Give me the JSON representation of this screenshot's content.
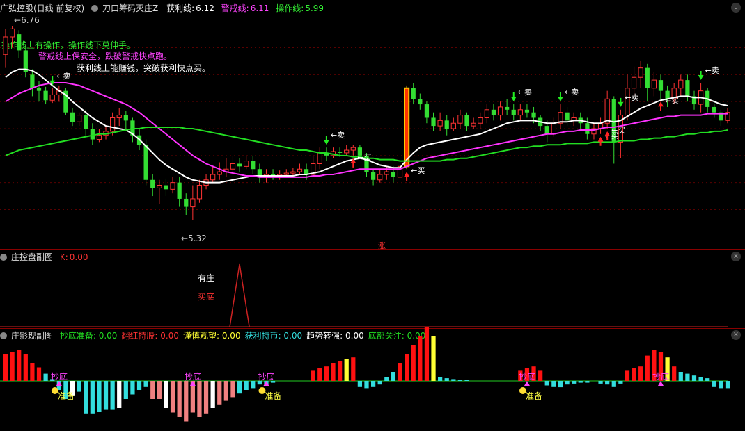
{
  "header": {
    "stock": "广弘控股(日线 前复权)",
    "indicator": "刀口筹码灭庄Z",
    "profit_label": "获利线:",
    "profit_value": "6.12",
    "warn_label": "警戒线:",
    "warn_value": "6.11",
    "op_label": "操作线:",
    "op_value": "5.99"
  },
  "notes": {
    "n1": "操作线上有操作，操作线下莫伸手。",
    "n2": "警戒线上保安全，跌破警戒快点跑。",
    "n3": "获利线上能赚钱，突破获利快点买。",
    "high_label": "6.76",
    "low_label": "5.32",
    "zhang": "涨"
  },
  "panel2": {
    "title": "庄控盘副图",
    "k_label": "K:",
    "k_value": "0.00",
    "you_zhuang": "有庄",
    "mai_di": "买底"
  },
  "panel3": {
    "title": "庄影现副图",
    "items": [
      {
        "label": "抄底准备:",
        "value": "0.00",
        "color": "#22dd22"
      },
      {
        "label": "翻红持股:",
        "value": "0.00",
        "color": "#ff3333"
      },
      {
        "label": "谨慎观望:",
        "value": "0.00",
        "color": "#ffff33"
      },
      {
        "label": "获利持币:",
        "value": "0.00",
        "color": "#33dddd"
      },
      {
        "label": "趋势转强:",
        "value": "0.00",
        "color": "#ffffff"
      },
      {
        "label": "底部关注:",
        "value": "0.00",
        "color": "#22dd22"
      }
    ],
    "chaodi": "抄底",
    "zhunbei": "准备"
  },
  "signals": {
    "buy": "买",
    "sell": "卖"
  },
  "colors": {
    "up": "#ff3333",
    "down": "#33dd33",
    "white": "#ffffff",
    "magenta": "#ff33ff",
    "green": "#22dd22"
  },
  "chart_data": {
    "type": "candlestick",
    "candles": [
      [
        6.55,
        6.68,
        6.74,
        6.45
      ],
      [
        6.68,
        6.74,
        6.76,
        6.6
      ],
      [
        6.7,
        6.58,
        6.73,
        6.52
      ],
      [
        6.58,
        6.42,
        6.62,
        6.38
      ],
      [
        6.4,
        6.3,
        6.44,
        6.24
      ],
      [
        6.3,
        6.28,
        6.35,
        6.2
      ],
      [
        6.28,
        6.21,
        6.31,
        6.18
      ],
      [
        6.21,
        6.25,
        6.3,
        6.19
      ],
      [
        6.25,
        6.28,
        6.32,
        6.2
      ],
      [
        6.28,
        6.12,
        6.3,
        6.1
      ],
      [
        6.12,
        6.05,
        6.15,
        6.02
      ],
      [
        6.05,
        6.1,
        6.12,
        6.02
      ],
      [
        6.1,
        6.0,
        6.14,
        5.95
      ],
      [
        6.0,
        5.92,
        6.04,
        5.88
      ],
      [
        5.92,
        5.95,
        6.0,
        5.9
      ],
      [
        5.95,
        5.98,
        6.02,
        5.92
      ],
      [
        5.98,
        6.08,
        6.12,
        5.95
      ],
      [
        6.08,
        6.1,
        6.15,
        6.02
      ],
      [
        6.1,
        6.06,
        6.13,
        6.0
      ],
      [
        6.06,
        5.95,
        6.08,
        5.9
      ],
      [
        5.95,
        5.88,
        6.0,
        5.84
      ],
      [
        5.88,
        5.62,
        5.92,
        5.58
      ],
      [
        5.62,
        5.56,
        5.66,
        5.5
      ],
      [
        5.56,
        5.58,
        5.62,
        5.44
      ],
      [
        5.58,
        5.55,
        5.63,
        5.5
      ],
      [
        5.55,
        5.6,
        5.64,
        5.52
      ],
      [
        5.6,
        5.48,
        5.64,
        5.42
      ],
      [
        5.48,
        5.42,
        5.52,
        5.36
      ],
      [
        5.42,
        5.48,
        5.58,
        5.32
      ],
      [
        5.48,
        5.58,
        5.62,
        5.45
      ],
      [
        5.58,
        5.62,
        5.66,
        5.55
      ],
      [
        5.62,
        5.66,
        5.72,
        5.6
      ],
      [
        5.66,
        5.68,
        5.75,
        5.62
      ],
      [
        5.68,
        5.7,
        5.78,
        5.64
      ],
      [
        5.7,
        5.74,
        5.8,
        5.66
      ],
      [
        5.74,
        5.72,
        5.78,
        5.68
      ],
      [
        5.72,
        5.76,
        5.8,
        5.7
      ],
      [
        5.76,
        5.7,
        5.8,
        5.66
      ],
      [
        5.7,
        5.64,
        5.74,
        5.6
      ],
      [
        5.64,
        5.66,
        5.7,
        5.6
      ],
      [
        5.66,
        5.65,
        5.7,
        5.62
      ],
      [
        5.65,
        5.66,
        5.69,
        5.62
      ],
      [
        5.66,
        5.67,
        5.7,
        5.64
      ],
      [
        5.67,
        5.68,
        5.71,
        5.64
      ],
      [
        5.68,
        5.7,
        5.74,
        5.66
      ],
      [
        5.7,
        5.66,
        5.74,
        5.62
      ],
      [
        5.66,
        5.74,
        5.8,
        5.64
      ],
      [
        5.74,
        5.82,
        5.86,
        5.7
      ],
      [
        5.82,
        5.8,
        5.86,
        5.76
      ],
      [
        5.8,
        5.83,
        5.86,
        5.78
      ],
      [
        5.83,
        5.82,
        5.86,
        5.79
      ],
      [
        5.82,
        5.84,
        5.88,
        5.8
      ],
      [
        5.84,
        5.86,
        5.88,
        5.8
      ],
      [
        5.86,
        5.8,
        5.88,
        5.78
      ],
      [
        5.8,
        5.68,
        5.82,
        5.64
      ],
      [
        5.68,
        5.62,
        5.7,
        5.58
      ],
      [
        5.62,
        5.66,
        5.7,
        5.6
      ],
      [
        5.66,
        5.68,
        5.72,
        5.62
      ],
      [
        5.68,
        5.64,
        5.72,
        5.6
      ],
      [
        5.64,
        5.72,
        5.76,
        5.6
      ],
      [
        5.72,
        6.3,
        6.32,
        5.7
      ],
      [
        6.3,
        6.22,
        6.34,
        6.18
      ],
      [
        6.22,
        6.18,
        6.26,
        6.14
      ],
      [
        6.18,
        6.08,
        6.2,
        6.04
      ],
      [
        6.08,
        6.02,
        6.12,
        5.98
      ],
      [
        6.02,
        6.06,
        6.12,
        5.98
      ],
      [
        6.06,
        6.0,
        6.1,
        5.95
      ],
      [
        6.0,
        6.04,
        6.08,
        5.98
      ],
      [
        6.04,
        6.1,
        6.14,
        6.0
      ],
      [
        6.1,
        6.02,
        6.12,
        5.98
      ],
      [
        6.02,
        6.04,
        6.08,
        6.0
      ],
      [
        6.04,
        6.08,
        6.12,
        6.0
      ],
      [
        6.08,
        6.14,
        6.18,
        6.04
      ],
      [
        6.14,
        6.1,
        6.18,
        6.06
      ],
      [
        6.1,
        6.16,
        6.2,
        6.06
      ],
      [
        6.16,
        6.14,
        6.22,
        6.1
      ],
      [
        6.14,
        6.1,
        6.18,
        6.06
      ],
      [
        6.1,
        6.14,
        6.18,
        6.06
      ],
      [
        6.14,
        6.12,
        6.18,
        6.08
      ],
      [
        6.12,
        6.08,
        6.16,
        6.04
      ],
      [
        6.08,
        6.02,
        6.1,
        5.98
      ],
      [
        6.02,
        5.96,
        6.06,
        5.9
      ],
      [
        5.96,
        6.04,
        6.08,
        5.94
      ],
      [
        6.04,
        6.12,
        6.18,
        6.0
      ],
      [
        6.12,
        6.06,
        6.16,
        6.02
      ],
      [
        6.06,
        6.08,
        6.12,
        6.02
      ],
      [
        6.08,
        6.04,
        6.12,
        5.98
      ],
      [
        6.04,
        5.96,
        6.08,
        5.92
      ],
      [
        5.96,
        6.0,
        6.04,
        5.92
      ],
      [
        6.0,
        6.04,
        6.08,
        5.96
      ],
      [
        6.04,
        6.22,
        6.28,
        6.0
      ],
      [
        6.22,
        5.9,
        6.24,
        5.74
      ],
      [
        5.9,
        6.1,
        6.14,
        5.78
      ],
      [
        6.1,
        6.3,
        6.4,
        6.06
      ],
      [
        6.3,
        6.38,
        6.46,
        6.24
      ],
      [
        6.38,
        6.45,
        6.5,
        6.3
      ],
      [
        6.45,
        6.3,
        6.48,
        6.2
      ],
      [
        6.3,
        6.36,
        6.42,
        6.24
      ],
      [
        6.36,
        6.28,
        6.4,
        6.22
      ],
      [
        6.28,
        6.22,
        6.32,
        6.16
      ],
      [
        6.22,
        6.3,
        6.34,
        6.18
      ],
      [
        6.3,
        6.36,
        6.4,
        6.24
      ],
      [
        6.36,
        6.24,
        6.4,
        6.2
      ],
      [
        6.24,
        6.18,
        6.28,
        6.14
      ],
      [
        6.18,
        6.28,
        6.34,
        6.12
      ],
      [
        6.28,
        6.16,
        6.3,
        6.12
      ],
      [
        6.16,
        6.12,
        6.18,
        6.08
      ],
      [
        6.12,
        6.06,
        6.14,
        6.02
      ],
      [
        6.06,
        6.12,
        6.15,
        6.04
      ]
    ],
    "ylim": [
      5.15,
      6.85
    ],
    "high_label": 6.76,
    "low_label": 5.32,
    "lines": [
      {
        "name": "获利线",
        "color": "#ffffff",
        "values": [
          6.38,
          6.42,
          6.44,
          6.44,
          6.43,
          6.4,
          6.36,
          6.32,
          6.28,
          6.25,
          6.2,
          6.16,
          6.12,
          6.08,
          6.05,
          6.02,
          6.01,
          6.0,
          5.99,
          5.96,
          5.92,
          5.87,
          5.82,
          5.77,
          5.73,
          5.7,
          5.67,
          5.64,
          5.62,
          5.61,
          5.6,
          5.6,
          5.6,
          5.61,
          5.62,
          5.63,
          5.64,
          5.65,
          5.65,
          5.65,
          5.65,
          5.65,
          5.65,
          5.65,
          5.66,
          5.66,
          5.67,
          5.68,
          5.7,
          5.72,
          5.74,
          5.76,
          5.77,
          5.78,
          5.77,
          5.75,
          5.73,
          5.72,
          5.71,
          5.71,
          5.77,
          5.82,
          5.86,
          5.88,
          5.89,
          5.9,
          5.91,
          5.92,
          5.93,
          5.94,
          5.95,
          5.96,
          5.98,
          6.0,
          6.02,
          6.04,
          6.05,
          6.06,
          6.06,
          6.06,
          6.05,
          6.04,
          6.04,
          6.05,
          6.05,
          6.06,
          6.06,
          6.05,
          6.04,
          6.04,
          6.06,
          6.05,
          6.06,
          6.09,
          6.12,
          6.15,
          6.17,
          6.19,
          6.21,
          6.22,
          6.23,
          6.24,
          6.24,
          6.23,
          6.23,
          6.22,
          6.2,
          6.18,
          6.17
        ]
      },
      {
        "name": "警戒线",
        "color": "#ff33ff",
        "values": [
          6.2,
          6.23,
          6.26,
          6.28,
          6.3,
          6.32,
          6.33,
          6.34,
          6.34,
          6.34,
          6.33,
          6.32,
          6.3,
          6.28,
          6.26,
          6.24,
          6.22,
          6.2,
          6.18,
          6.15,
          6.12,
          6.08,
          6.04,
          6.0,
          5.96,
          5.92,
          5.88,
          5.84,
          5.8,
          5.77,
          5.74,
          5.72,
          5.7,
          5.68,
          5.67,
          5.66,
          5.65,
          5.65,
          5.64,
          5.64,
          5.64,
          5.64,
          5.64,
          5.64,
          5.64,
          5.64,
          5.65,
          5.65,
          5.66,
          5.66,
          5.67,
          5.68,
          5.69,
          5.7,
          5.7,
          5.7,
          5.7,
          5.7,
          5.7,
          5.7,
          5.72,
          5.74,
          5.76,
          5.78,
          5.79,
          5.8,
          5.81,
          5.82,
          5.83,
          5.84,
          5.85,
          5.86,
          5.87,
          5.88,
          5.89,
          5.9,
          5.91,
          5.92,
          5.93,
          5.94,
          5.95,
          5.96,
          5.96,
          5.97,
          5.98,
          5.98,
          5.99,
          5.99,
          5.99,
          6.0,
          6.01,
          6.01,
          6.02,
          6.03,
          6.04,
          6.05,
          6.06,
          6.07,
          6.08,
          6.09,
          6.09,
          6.1,
          6.1,
          6.1,
          6.1,
          6.11,
          6.11,
          6.11,
          6.11
        ]
      },
      {
        "name": "操作线",
        "color": "#22dd22",
        "values": [
          5.8,
          5.82,
          5.84,
          5.85,
          5.86,
          5.87,
          5.88,
          5.89,
          5.9,
          5.91,
          5.92,
          5.93,
          5.94,
          5.95,
          5.96,
          5.96,
          5.97,
          5.98,
          5.99,
          6.0,
          6.0,
          6.01,
          6.01,
          6.01,
          6.01,
          6.01,
          6.01,
          6.0,
          6.0,
          5.99,
          5.98,
          5.97,
          5.96,
          5.95,
          5.94,
          5.93,
          5.92,
          5.91,
          5.9,
          5.89,
          5.88,
          5.87,
          5.86,
          5.85,
          5.84,
          5.84,
          5.83,
          5.82,
          5.82,
          5.81,
          5.8,
          5.8,
          5.79,
          5.79,
          5.78,
          5.78,
          5.77,
          5.77,
          5.77,
          5.76,
          5.76,
          5.76,
          5.76,
          5.76,
          5.76,
          5.76,
          5.77,
          5.77,
          5.78,
          5.78,
          5.79,
          5.8,
          5.81,
          5.82,
          5.83,
          5.84,
          5.85,
          5.86,
          5.86,
          5.87,
          5.87,
          5.88,
          5.88,
          5.88,
          5.89,
          5.89,
          5.89,
          5.89,
          5.9,
          5.9,
          5.9,
          5.9,
          5.91,
          5.91,
          5.91,
          5.92,
          5.92,
          5.93,
          5.93,
          5.94,
          5.94,
          5.95,
          5.96,
          5.96,
          5.97,
          5.97,
          5.98,
          5.98,
          5.99
        ]
      }
    ],
    "buy_signals": [
      52,
      60,
      89,
      90,
      98
    ],
    "sell_signals": [
      7,
      48,
      76,
      83,
      92,
      104
    ],
    "k_spike_index": 35,
    "sub_bars": [
      3,
      3.2,
      3.4,
      3,
      2,
      1.5,
      0.8,
      0.2,
      -1,
      -2,
      -1.6,
      -1.2,
      -3.6,
      -3.6,
      -3.4,
      -3.2,
      -3.2,
      -3,
      -2,
      -1.5,
      -1,
      -0.6,
      -2,
      -2,
      -3,
      -3.5,
      -4,
      -4.5,
      -3.5,
      -4,
      -3.6,
      -3,
      -2.6,
      -2.2,
      -1.8,
      -1.4,
      -1,
      -0.8,
      -0.4,
      -0.4,
      -0.2,
      0,
      0,
      0,
      0,
      0,
      1.2,
      1.4,
      1.6,
      2,
      2.2,
      2.4,
      2.6,
      -0.6,
      -0.8,
      -0.6,
      -0.4,
      0.4,
      1,
      2,
      3,
      4,
      5,
      6,
      5,
      0.4,
      0.3,
      0.2,
      0.1,
      0.1,
      0,
      0,
      0,
      0,
      0,
      0,
      0,
      1.2,
      1.4,
      1.6,
      1.2,
      -0.5,
      -0.6,
      -0.7,
      -0.4,
      -0.3,
      -0.2,
      -0.2,
      0,
      -0.3,
      -0.4,
      -0.6,
      -0.3,
      1.2,
      1.4,
      1.6,
      2.8,
      3.4,
      3.2,
      2.6,
      1.6,
      1,
      0.8,
      0.6,
      0.4,
      0.3,
      -0.6,
      -0.8,
      -0.8
    ]
  }
}
